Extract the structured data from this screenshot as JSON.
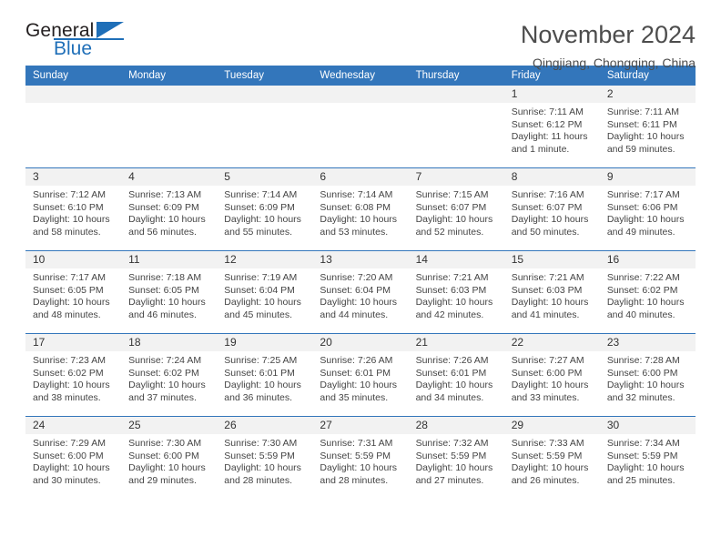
{
  "logo": {
    "word1": "General",
    "word2": "Blue",
    "accent_color": "#1f6fb8",
    "triangle_icon": "triangle-right-icon"
  },
  "header": {
    "title": "November 2024",
    "subtitle": "Qingjiang, Chongqing, China"
  },
  "calendar": {
    "header_color": "#3376bb",
    "weekdays": [
      "Sunday",
      "Monday",
      "Tuesday",
      "Wednesday",
      "Thursday",
      "Friday",
      "Saturday"
    ],
    "labels": {
      "sunrise": "Sunrise:",
      "sunset": "Sunset:",
      "daylight": "Daylight:"
    },
    "weeks": [
      [
        {
          "day": "",
          "sunrise": "",
          "sunset": "",
          "daylight": "",
          "empty": true
        },
        {
          "day": "",
          "sunrise": "",
          "sunset": "",
          "daylight": "",
          "empty": true
        },
        {
          "day": "",
          "sunrise": "",
          "sunset": "",
          "daylight": "",
          "empty": true
        },
        {
          "day": "",
          "sunrise": "",
          "sunset": "",
          "daylight": "",
          "empty": true
        },
        {
          "day": "",
          "sunrise": "",
          "sunset": "",
          "daylight": "",
          "empty": true
        },
        {
          "day": "1",
          "sunrise": "Sunrise: 7:11 AM",
          "sunset": "Sunset: 6:12 PM",
          "daylight": "Daylight: 11 hours and 1 minute.",
          "empty": false
        },
        {
          "day": "2",
          "sunrise": "Sunrise: 7:11 AM",
          "sunset": "Sunset: 6:11 PM",
          "daylight": "Daylight: 10 hours and 59 minutes.",
          "empty": false
        }
      ],
      [
        {
          "day": "3",
          "sunrise": "Sunrise: 7:12 AM",
          "sunset": "Sunset: 6:10 PM",
          "daylight": "Daylight: 10 hours and 58 minutes.",
          "empty": false
        },
        {
          "day": "4",
          "sunrise": "Sunrise: 7:13 AM",
          "sunset": "Sunset: 6:09 PM",
          "daylight": "Daylight: 10 hours and 56 minutes.",
          "empty": false
        },
        {
          "day": "5",
          "sunrise": "Sunrise: 7:14 AM",
          "sunset": "Sunset: 6:09 PM",
          "daylight": "Daylight: 10 hours and 55 minutes.",
          "empty": false
        },
        {
          "day": "6",
          "sunrise": "Sunrise: 7:14 AM",
          "sunset": "Sunset: 6:08 PM",
          "daylight": "Daylight: 10 hours and 53 minutes.",
          "empty": false
        },
        {
          "day": "7",
          "sunrise": "Sunrise: 7:15 AM",
          "sunset": "Sunset: 6:07 PM",
          "daylight": "Daylight: 10 hours and 52 minutes.",
          "empty": false
        },
        {
          "day": "8",
          "sunrise": "Sunrise: 7:16 AM",
          "sunset": "Sunset: 6:07 PM",
          "daylight": "Daylight: 10 hours and 50 minutes.",
          "empty": false
        },
        {
          "day": "9",
          "sunrise": "Sunrise: 7:17 AM",
          "sunset": "Sunset: 6:06 PM",
          "daylight": "Daylight: 10 hours and 49 minutes.",
          "empty": false
        }
      ],
      [
        {
          "day": "10",
          "sunrise": "Sunrise: 7:17 AM",
          "sunset": "Sunset: 6:05 PM",
          "daylight": "Daylight: 10 hours and 48 minutes.",
          "empty": false
        },
        {
          "day": "11",
          "sunrise": "Sunrise: 7:18 AM",
          "sunset": "Sunset: 6:05 PM",
          "daylight": "Daylight: 10 hours and 46 minutes.",
          "empty": false
        },
        {
          "day": "12",
          "sunrise": "Sunrise: 7:19 AM",
          "sunset": "Sunset: 6:04 PM",
          "daylight": "Daylight: 10 hours and 45 minutes.",
          "empty": false
        },
        {
          "day": "13",
          "sunrise": "Sunrise: 7:20 AM",
          "sunset": "Sunset: 6:04 PM",
          "daylight": "Daylight: 10 hours and 44 minutes.",
          "empty": false
        },
        {
          "day": "14",
          "sunrise": "Sunrise: 7:21 AM",
          "sunset": "Sunset: 6:03 PM",
          "daylight": "Daylight: 10 hours and 42 minutes.",
          "empty": false
        },
        {
          "day": "15",
          "sunrise": "Sunrise: 7:21 AM",
          "sunset": "Sunset: 6:03 PM",
          "daylight": "Daylight: 10 hours and 41 minutes.",
          "empty": false
        },
        {
          "day": "16",
          "sunrise": "Sunrise: 7:22 AM",
          "sunset": "Sunset: 6:02 PM",
          "daylight": "Daylight: 10 hours and 40 minutes.",
          "empty": false
        }
      ],
      [
        {
          "day": "17",
          "sunrise": "Sunrise: 7:23 AM",
          "sunset": "Sunset: 6:02 PM",
          "daylight": "Daylight: 10 hours and 38 minutes.",
          "empty": false
        },
        {
          "day": "18",
          "sunrise": "Sunrise: 7:24 AM",
          "sunset": "Sunset: 6:02 PM",
          "daylight": "Daylight: 10 hours and 37 minutes.",
          "empty": false
        },
        {
          "day": "19",
          "sunrise": "Sunrise: 7:25 AM",
          "sunset": "Sunset: 6:01 PM",
          "daylight": "Daylight: 10 hours and 36 minutes.",
          "empty": false
        },
        {
          "day": "20",
          "sunrise": "Sunrise: 7:26 AM",
          "sunset": "Sunset: 6:01 PM",
          "daylight": "Daylight: 10 hours and 35 minutes.",
          "empty": false
        },
        {
          "day": "21",
          "sunrise": "Sunrise: 7:26 AM",
          "sunset": "Sunset: 6:01 PM",
          "daylight": "Daylight: 10 hours and 34 minutes.",
          "empty": false
        },
        {
          "day": "22",
          "sunrise": "Sunrise: 7:27 AM",
          "sunset": "Sunset: 6:00 PM",
          "daylight": "Daylight: 10 hours and 33 minutes.",
          "empty": false
        },
        {
          "day": "23",
          "sunrise": "Sunrise: 7:28 AM",
          "sunset": "Sunset: 6:00 PM",
          "daylight": "Daylight: 10 hours and 32 minutes.",
          "empty": false
        }
      ],
      [
        {
          "day": "24",
          "sunrise": "Sunrise: 7:29 AM",
          "sunset": "Sunset: 6:00 PM",
          "daylight": "Daylight: 10 hours and 30 minutes.",
          "empty": false
        },
        {
          "day": "25",
          "sunrise": "Sunrise: 7:30 AM",
          "sunset": "Sunset: 6:00 PM",
          "daylight": "Daylight: 10 hours and 29 minutes.",
          "empty": false
        },
        {
          "day": "26",
          "sunrise": "Sunrise: 7:30 AM",
          "sunset": "Sunset: 5:59 PM",
          "daylight": "Daylight: 10 hours and 28 minutes.",
          "empty": false
        },
        {
          "day": "27",
          "sunrise": "Sunrise: 7:31 AM",
          "sunset": "Sunset: 5:59 PM",
          "daylight": "Daylight: 10 hours and 28 minutes.",
          "empty": false
        },
        {
          "day": "28",
          "sunrise": "Sunrise: 7:32 AM",
          "sunset": "Sunset: 5:59 PM",
          "daylight": "Daylight: 10 hours and 27 minutes.",
          "empty": false
        },
        {
          "day": "29",
          "sunrise": "Sunrise: 7:33 AM",
          "sunset": "Sunset: 5:59 PM",
          "daylight": "Daylight: 10 hours and 26 minutes.",
          "empty": false
        },
        {
          "day": "30",
          "sunrise": "Sunrise: 7:34 AM",
          "sunset": "Sunset: 5:59 PM",
          "daylight": "Daylight: 10 hours and 25 minutes.",
          "empty": false
        }
      ]
    ]
  }
}
